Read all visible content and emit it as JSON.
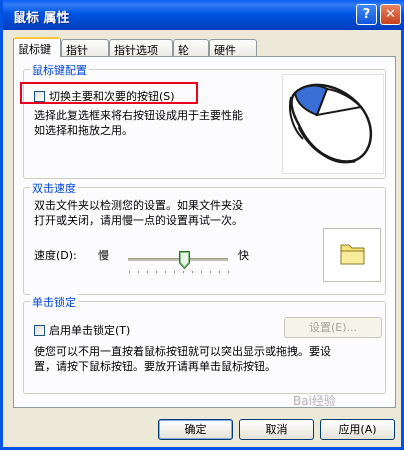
{
  "window": {
    "title": "鼠标 属性",
    "help_label": "?",
    "close_label": "✕"
  },
  "tabs": [
    {
      "label": "鼠标键",
      "active": true
    },
    {
      "label": "指针"
    },
    {
      "label": "指针选项"
    },
    {
      "label": "轮"
    },
    {
      "label": "硬件"
    }
  ],
  "buttons_config": {
    "group_title": "鼠标键配置",
    "swap_checkbox_label": "切换主要和次要的按钮(S)",
    "swap_checked": false,
    "description_line1": "选择此复选框来将右按钮设成用于主要性能",
    "description_line2": "如选择和拖放之用。",
    "image_icon": "mouse-icon"
  },
  "double_click": {
    "group_title": "双击速度",
    "description_line1": "双击文件夹以检测您的设置。如果文件夹没",
    "description_line2": "打开或关闭，请用慢一点的设置再试一次。",
    "speed_label": "速度(D):",
    "slow_label": "慢",
    "fast_label": "快",
    "speed_fraction": 0.6,
    "test_icon": "folder-icon"
  },
  "click_lock": {
    "group_title": "单击锁定",
    "checkbox_label": "启用单击锁定(T)",
    "checked": false,
    "settings_button": "设置(E)...",
    "description_line1": "使您可以不用一直按着鼠标按钮就可以突出显示或拖拽。要设",
    "description_line2": "置，请按下鼠标按钮。要放开请再单击鼠标按钮。"
  },
  "footer": {
    "ok_label": "确定",
    "cancel_label": "取消",
    "apply_label": "应用(A)"
  },
  "watermark": "Bai经验",
  "colors": {
    "titlebar": "#0054e3",
    "group_title": "#0046d5",
    "highlight": "#e8001c"
  }
}
